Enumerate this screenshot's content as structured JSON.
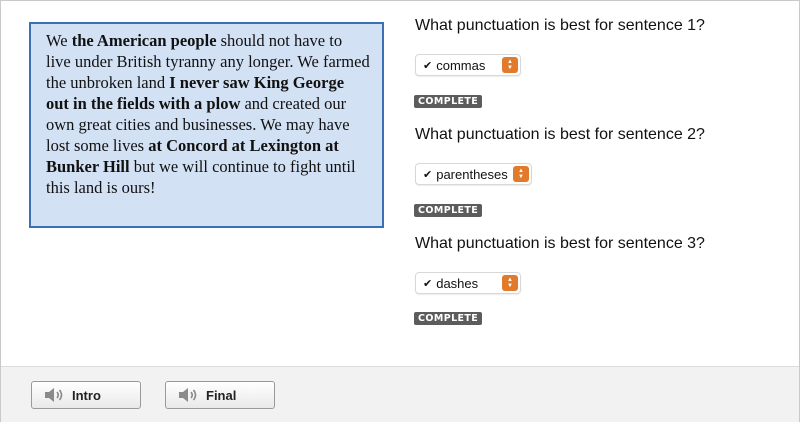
{
  "passage": {
    "segments": [
      {
        "text": "We ",
        "bold": false
      },
      {
        "text": "the American people",
        "bold": true
      },
      {
        "text": " should not have to live under British tyranny any longer. We farmed the unbroken land ",
        "bold": false
      },
      {
        "text": "I never saw King George out in the fields with a plow",
        "bold": true
      },
      {
        "text": " and created our own great cities and businesses. We may have lost some lives ",
        "bold": false
      },
      {
        "text": "at Concord at Lexington at Bunker Hill",
        "bold": true
      },
      {
        "text": " but we will continue to fight until this land is ours!",
        "bold": false
      }
    ]
  },
  "questions": [
    {
      "prompt": "What punctuation is best for sentence 1?",
      "selected": "commas",
      "status": "COMPLETE"
    },
    {
      "prompt": "What punctuation is best for sentence 2?",
      "selected": "parentheses",
      "status": "COMPLETE"
    },
    {
      "prompt": "What punctuation is best for sentence 3?",
      "selected": "dashes",
      "status": "COMPLETE"
    }
  ],
  "footer": {
    "intro_label": "Intro",
    "final_label": "Final",
    "speaker_icon": "speaker-icon"
  },
  "colors": {
    "passage_bg": "#d3e1f5",
    "passage_border": "#3d6fb6",
    "select_arrow": "#e27a2c",
    "badge_bg": "#5c5c5c"
  }
}
